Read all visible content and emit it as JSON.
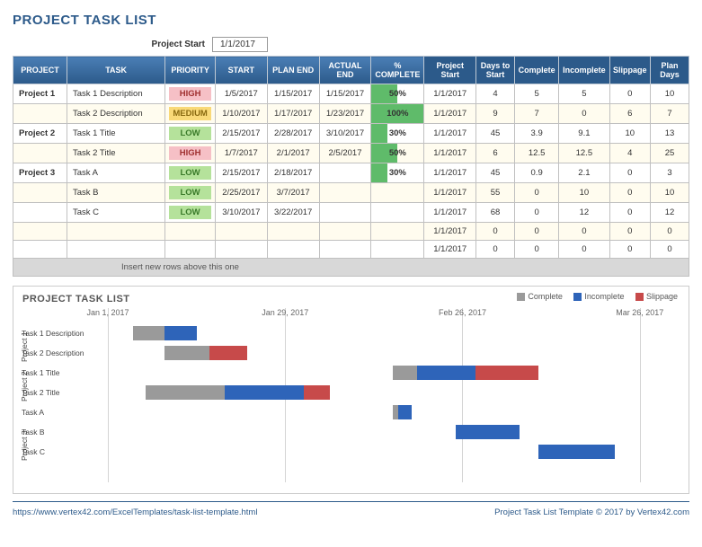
{
  "title": "PROJECT TASK LIST",
  "project_start": {
    "label": "Project Start",
    "value": "1/1/2017"
  },
  "headers": {
    "project": "PROJECT",
    "task": "TASK",
    "priority": "PRIORITY",
    "start": "START",
    "plan_end": "PLAN END",
    "actual_end": "ACTUAL END",
    "pct": "% COMPLETE",
    "pstart": "Project Start",
    "days_to_start": "Days to Start",
    "complete": "Complete",
    "incomplete": "Incomplete",
    "slippage": "Slippage",
    "plan_days": "Plan Days"
  },
  "rows": [
    {
      "project": "Project 1",
      "task": "Task 1 Description",
      "priority": "HIGH",
      "start": "1/5/2017",
      "plan_end": "1/15/2017",
      "actual_end": "1/15/2017",
      "pct": 50,
      "pstart": "1/1/2017",
      "days_to_start": 4,
      "complete": 5,
      "incomplete": 5,
      "slippage": 0,
      "plan_days": 10,
      "odd": false
    },
    {
      "project": "",
      "task": "Task 2 Description",
      "priority": "MEDIUM",
      "start": "1/10/2017",
      "plan_end": "1/17/2017",
      "actual_end": "1/23/2017",
      "pct": 100,
      "pstart": "1/1/2017",
      "days_to_start": 9,
      "complete": 7,
      "incomplete": 0,
      "slippage": 6,
      "plan_days": 7,
      "odd": true
    },
    {
      "project": "Project 2",
      "task": "Task 1 Title",
      "priority": "LOW",
      "start": "2/15/2017",
      "plan_end": "2/28/2017",
      "actual_end": "3/10/2017",
      "pct": 30,
      "pstart": "1/1/2017",
      "days_to_start": 45,
      "complete": 3.9,
      "incomplete": 9.1,
      "slippage": 10,
      "plan_days": 13,
      "odd": false
    },
    {
      "project": "",
      "task": "Task 2 Title",
      "priority": "HIGH",
      "start": "1/7/2017",
      "plan_end": "2/1/2017",
      "actual_end": "2/5/2017",
      "pct": 50,
      "pstart": "1/1/2017",
      "days_to_start": 6,
      "complete": 12.5,
      "incomplete": 12.5,
      "slippage": 4,
      "plan_days": 25,
      "odd": true
    },
    {
      "project": "Project 3",
      "task": "Task A",
      "priority": "LOW",
      "start": "2/15/2017",
      "plan_end": "2/18/2017",
      "actual_end": "",
      "pct": 30,
      "pstart": "1/1/2017",
      "days_to_start": 45,
      "complete": 0.9,
      "incomplete": 2.1,
      "slippage": 0,
      "plan_days": 3,
      "odd": false
    },
    {
      "project": "",
      "task": "Task B",
      "priority": "LOW",
      "start": "2/25/2017",
      "plan_end": "3/7/2017",
      "actual_end": "",
      "pct": null,
      "pstart": "1/1/2017",
      "days_to_start": 55,
      "complete": 0,
      "incomplete": 10,
      "slippage": 0,
      "plan_days": 10,
      "odd": true
    },
    {
      "project": "",
      "task": "Task C",
      "priority": "LOW",
      "start": "3/10/2017",
      "plan_end": "3/22/2017",
      "actual_end": "",
      "pct": null,
      "pstart": "1/1/2017",
      "days_to_start": 68,
      "complete": 0,
      "incomplete": 12,
      "slippage": 0,
      "plan_days": 12,
      "odd": false
    },
    {
      "project": "",
      "task": "",
      "priority": "",
      "start": "",
      "plan_end": "",
      "actual_end": "",
      "pct": null,
      "pstart": "1/1/2017",
      "days_to_start": 0,
      "complete": 0,
      "incomplete": 0,
      "slippage": 0,
      "plan_days": 0,
      "odd": true
    },
    {
      "project": "",
      "task": "",
      "priority": "",
      "start": "",
      "plan_end": "",
      "actual_end": "",
      "pct": null,
      "pstart": "1/1/2017",
      "days_to_start": 0,
      "complete": 0,
      "incomplete": 0,
      "slippage": 0,
      "plan_days": 0,
      "odd": false
    }
  ],
  "insert_row_text": "Insert new rows above this one",
  "chart": {
    "title": "PROJECT TASK LIST",
    "legend": {
      "complete": "Complete",
      "incomplete": "Incomplete",
      "slippage": "Slippage"
    },
    "date_labels": [
      "Jan 1, 2017",
      "Jan 29, 2017",
      "Feb 26, 2017",
      "Mar 26, 2017"
    ],
    "groups": [
      "Project 1",
      "Project 2",
      "Project 3"
    ]
  },
  "chart_data": {
    "type": "bar",
    "orientation": "horizontal_stacked",
    "x_unit": "days since 2017-01-01",
    "xlim": [
      0,
      90
    ],
    "date_ticks": [
      0,
      28,
      56,
      84
    ],
    "date_tick_labels": [
      "Jan 1, 2017",
      "Jan 29, 2017",
      "Feb 26, 2017",
      "Mar 26, 2017"
    ],
    "series_legend": [
      "Complete",
      "Incomplete",
      "Slippage"
    ],
    "categories": [
      "Task 1 Description",
      "Task 2 Description",
      "Task 1 Title",
      "Task 2 Title",
      "Task A",
      "Task B",
      "Task C"
    ],
    "group_of_category": [
      "Project 1",
      "Project 1",
      "Project 2",
      "Project 2",
      "Project 3",
      "Project 3",
      "Project 3"
    ],
    "offset": [
      4,
      9,
      45,
      6,
      45,
      55,
      68
    ],
    "series": [
      {
        "name": "Complete",
        "color": "#9a9a9a",
        "values": [
          5,
          7,
          3.9,
          12.5,
          0.9,
          0,
          0
        ]
      },
      {
        "name": "Incomplete",
        "color": "#2e64b9",
        "values": [
          5,
          0,
          9.1,
          12.5,
          2.1,
          10,
          12
        ]
      },
      {
        "name": "Slippage",
        "color": "#c74a4a",
        "values": [
          0,
          6,
          10,
          4,
          0,
          0,
          0
        ]
      }
    ]
  },
  "footer": {
    "left": "https://www.vertex42.com/ExcelTemplates/task-list-template.html",
    "right": "Project Task List Template © 2017 by Vertex42.com"
  }
}
